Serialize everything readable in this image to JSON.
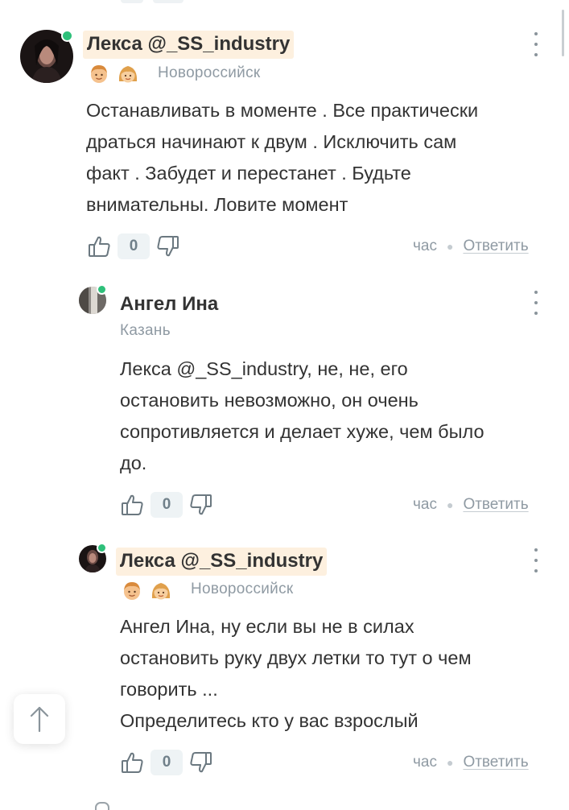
{
  "comments": [
    {
      "author": "Лекса @_SS_industry",
      "location": "Новороссийск",
      "badges": [
        "boy-emoji-icon",
        "girl-emoji-icon"
      ],
      "lines": [
        "Останавливать в моменте . Все практически",
        "драться начинают к двум . Исключить сам",
        "факт . Забудет и перестанет . Будьте",
        "внимательны. Ловите момент"
      ],
      "likes": "0",
      "time": "час",
      "reply_label": "Ответить"
    },
    {
      "author": "Ангел Ина",
      "location": "Казань",
      "badges": [],
      "lines": [
        "Лекса @_SS_industry, не, не, его",
        "остановить невозможно, он очень",
        "сопротивляется и делает хуже, чем было",
        "до."
      ],
      "likes": "0",
      "time": "час",
      "reply_label": "Ответить"
    },
    {
      "author": "Лекса @_SS_industry",
      "location": "Новороссийск",
      "badges": [
        "boy-emoji-icon",
        "girl-emoji-icon"
      ],
      "lines": [
        "Ангел Ина, ну если вы не в силах",
        "остановить руку двух летки то тут о чем",
        "говорить ...",
        "Определитесь кто у вас взрослый"
      ],
      "likes": "0",
      "time": "час",
      "reply_label": "Ответить"
    }
  ],
  "colors": {
    "online": "#2ec07a",
    "name_highlight": "#fdf0df",
    "muted": "#8f9aa3",
    "count_bg": "#eef3f5"
  },
  "scroll_top_icon": "arrow-up-icon"
}
